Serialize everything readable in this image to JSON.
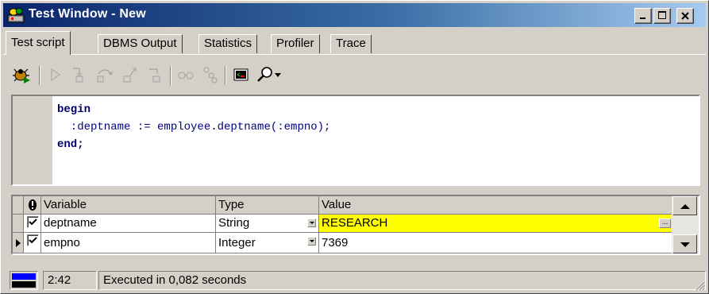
{
  "window": {
    "title": "Test Window - New"
  },
  "title_buttons": {
    "minimize": "_",
    "maximize": "□",
    "close": "x"
  },
  "tabs": [
    {
      "label": "Test script",
      "active": true
    },
    {
      "label": "DBMS Output",
      "active": false
    },
    {
      "label": "Statistics",
      "active": false
    },
    {
      "label": "Profiler",
      "active": false
    },
    {
      "label": "Trace",
      "active": false
    }
  ],
  "toolbar": {
    "icons": [
      "debug-start-icon",
      "run-icon",
      "step-into-icon",
      "step-over-icon",
      "step-out-icon",
      "run-to-exception-icon",
      "watch-icon",
      "toggle-breakpoint-icon",
      "console-icon",
      "search-icon"
    ]
  },
  "editor": {
    "line1": "begin",
    "line2": "  :deptname := employee.deptname(:empno);",
    "line3": "end;"
  },
  "grid": {
    "columns": {
      "warning": "!",
      "variable": "Variable",
      "type": "Type",
      "value": "Value"
    },
    "rows": [
      {
        "checked": true,
        "variable": "deptname",
        "type": "String",
        "value": "RESEARCH",
        "highlighted": true
      },
      {
        "checked": true,
        "variable": "empno",
        "type": "Integer",
        "value": "7369",
        "current": true
      }
    ],
    "ellipsis": "..."
  },
  "status": {
    "position": "2:42",
    "message": "Executed in 0,082 seconds"
  },
  "colors": {
    "highlight": "#ffff00",
    "code": "#000080",
    "title_start": "#0a246a",
    "title_end": "#a6caf0"
  }
}
